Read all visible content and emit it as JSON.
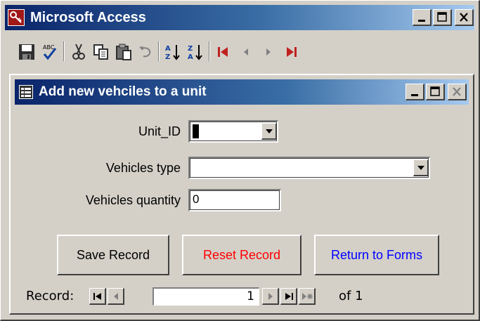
{
  "app": {
    "title": "Microsoft Access",
    "icon": "access-key-icon",
    "controls": [
      "minimize-icon",
      "maximize-icon",
      "close-icon"
    ]
  },
  "toolbar": {
    "icons": [
      "save-icon",
      "spelling-icon",
      "cut-icon",
      "copy-icon",
      "paste-icon",
      "undo-icon",
      "sort-ascending-icon",
      "sort-descending-icon",
      "first-record-icon",
      "previous-record-icon",
      "next-record-icon",
      "last-record-icon"
    ]
  },
  "form": {
    "title": "Add new vehciles to a unit",
    "icon": "form-icon",
    "fields": {
      "unit_id": {
        "label": "Unit_ID",
        "value": ""
      },
      "vehicles_type": {
        "label": "Vehicles type",
        "value": ""
      },
      "vehicles_quantity": {
        "label": "Vehicles quantity",
        "value": "0"
      }
    },
    "buttons": {
      "save": {
        "label": "Save Record",
        "color": "#000000"
      },
      "reset": {
        "label": "Reset Record",
        "color": "#ff0000"
      },
      "return": {
        "label": "Return to Forms",
        "color": "#0000ff"
      }
    },
    "record_nav": {
      "label": "Record:",
      "current": "1",
      "of_text": "of 1"
    }
  },
  "colors": {
    "face": "#d4d0c8",
    "title_start": "#0a246a",
    "title_end": "#a6caf0"
  }
}
